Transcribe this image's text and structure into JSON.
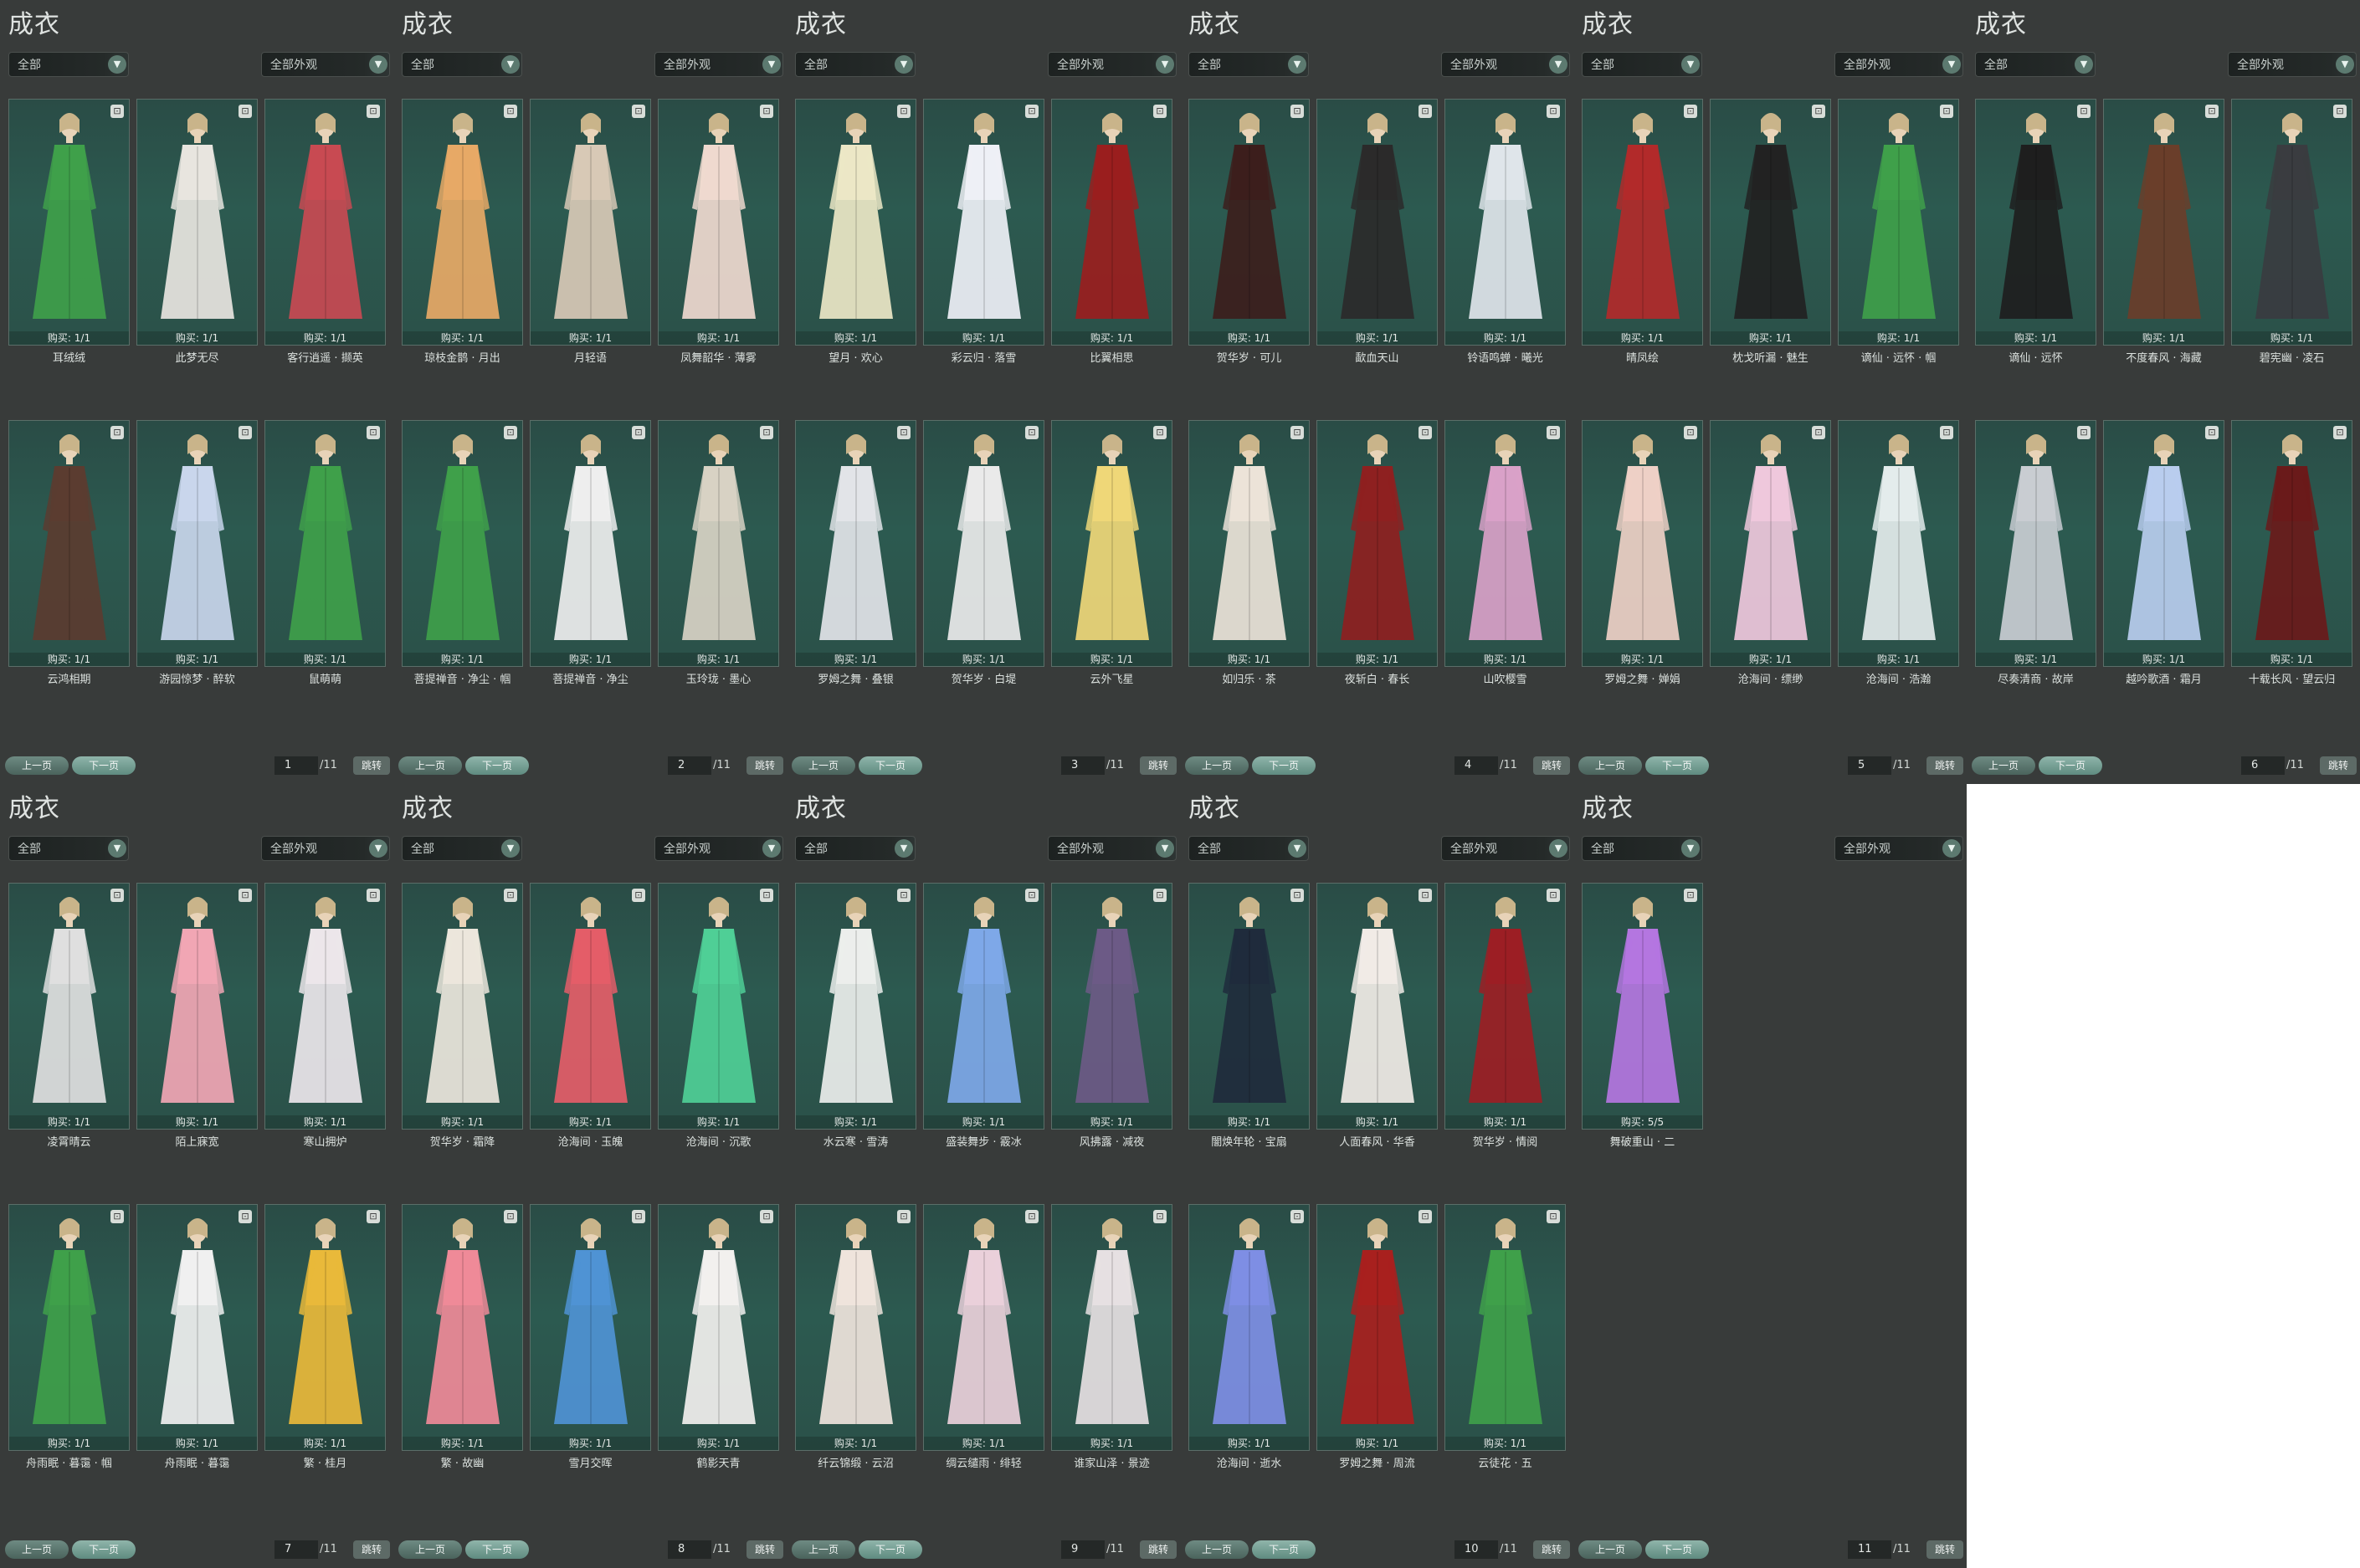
{
  "colors": {
    "panel_bg": "#383b3a",
    "card_bg": "#2c5a50",
    "page_bg": "#ffffff"
  },
  "panels": [
    {
      "title": "成衣",
      "filter_left": "全部",
      "filter_right": "全部外观",
      "items": [
        {
          "name": "耳绒绒",
          "buy": "购买: 1/1",
          "color": "#3fa04a"
        },
        {
          "name": "此梦无尽",
          "buy": "购买: 1/1",
          "color": "#e8e5df"
        },
        {
          "name": "客行逍遥 · 撷英",
          "buy": "购买: 1/1",
          "color": "#c84a52"
        },
        {
          "name": "云鸿相期",
          "buy": "购买: 1/1",
          "color": "#5b3c30"
        },
        {
          "name": "游园惊梦 · 醉软",
          "buy": "购买: 1/1",
          "color": "#c9d6ec"
        },
        {
          "name": "鼠萌萌",
          "buy": "购买: 1/1",
          "color": "#3fa04a"
        }
      ],
      "pager": {
        "prev": "上一页",
        "next": "下一页",
        "page": "1",
        "total": "/11",
        "jump": "跳转"
      }
    },
    {
      "title": "成衣",
      "filter_left": "全部",
      "filter_right": "全部外观",
      "items": [
        {
          "name": "琼枝金鹊 · 月出",
          "buy": "购买: 1/1",
          "color": "#e7a966"
        },
        {
          "name": "月轻语",
          "buy": "购买: 1/1",
          "color": "#d8c9b6"
        },
        {
          "name": "凤舞韶华 · 薄雾",
          "buy": "购买: 1/1",
          "color": "#efd9cf"
        },
        {
          "name": "菩提禅音 · 净尘 · 帼",
          "buy": "购买: 1/1",
          "color": "#3fa04a"
        },
        {
          "name": "菩提禅音 · 净尘",
          "buy": "购买: 1/1",
          "color": "#eeeeee"
        },
        {
          "name": "玉玲珑 · 墨心",
          "buy": "购买: 1/1",
          "color": "#d8d2c4"
        }
      ],
      "pager": {
        "prev": "上一页",
        "next": "下一页",
        "page": "2",
        "total": "/11",
        "jump": "跳转"
      }
    },
    {
      "title": "成衣",
      "filter_left": "全部",
      "filter_right": "全部外观",
      "items": [
        {
          "name": "望月 · 欢心",
          "buy": "购买: 1/1",
          "color": "#ece7c6"
        },
        {
          "name": "彩云归 · 落雪",
          "buy": "购买: 1/1",
          "color": "#eef0f6"
        },
        {
          "name": "比翼相思",
          "buy": "购买: 1/1",
          "color": "#9a1e1e"
        },
        {
          "name": "罗姆之舞 · 叠银",
          "buy": "购买: 1/1",
          "color": "#e2e4e8"
        },
        {
          "name": "贺华岁 · 白堤",
          "buy": "购买: 1/1",
          "color": "#eaeaea"
        },
        {
          "name": "云外飞星",
          "buy": "购买: 1/1",
          "color": "#efd778"
        }
      ],
      "pager": {
        "prev": "上一页",
        "next": "下一页",
        "page": "3",
        "total": "/11",
        "jump": "跳转"
      }
    },
    {
      "title": "成衣",
      "filter_left": "全部",
      "filter_right": "全部外观",
      "items": [
        {
          "name": "贺华岁 · 可儿",
          "buy": "购买: 1/1",
          "color": "#3c1e1c"
        },
        {
          "name": "歃血天山",
          "buy": "购买: 1/1",
          "color": "#2b2a2a"
        },
        {
          "name": "铃语鸣蝉 · 曦光",
          "buy": "购买: 1/1",
          "color": "#dfe5ea"
        },
        {
          "name": "如归乐 · 茶",
          "buy": "购买: 1/1",
          "color": "#ece3d8"
        },
        {
          "name": "夜斩白 · 春长",
          "buy": "购买: 1/1",
          "color": "#8e2020"
        },
        {
          "name": "山吹樱雪",
          "buy": "购买: 1/1",
          "color": "#d9a1c8"
        }
      ],
      "pager": {
        "prev": "上一页",
        "next": "下一页",
        "page": "4",
        "total": "/11",
        "jump": "跳转"
      }
    },
    {
      "title": "成衣",
      "filter_left": "全部",
      "filter_right": "全部外观",
      "items": [
        {
          "name": "晴凤绘",
          "buy": "购买: 1/1",
          "color": "#b22a2a"
        },
        {
          "name": "枕戈听漏 · 魅生",
          "buy": "购买: 1/1",
          "color": "#222222"
        },
        {
          "name": "谪仙 · 远怀 · 帼",
          "buy": "购买: 1/1",
          "color": "#3fa04a"
        },
        {
          "name": "罗姆之舞 · 婵娟",
          "buy": "购买: 1/1",
          "color": "#eed0c6"
        },
        {
          "name": "沧海间 · 缥缈",
          "buy": "购买: 1/1",
          "color": "#efc8dc"
        },
        {
          "name": "沧海间 · 浩瀚",
          "buy": "购买: 1/1",
          "color": "#e4ecec"
        }
      ],
      "pager": {
        "prev": "上一页",
        "next": "下一页",
        "page": "5",
        "total": "/11",
        "jump": "跳转"
      }
    },
    {
      "title": "成衣",
      "filter_left": "全部",
      "filter_right": "全部外观",
      "items": [
        {
          "name": "谪仙 · 远怀",
          "buy": "购买: 1/1",
          "color": "#1e1e1e"
        },
        {
          "name": "不度春风 · 海藏",
          "buy": "购买: 1/1",
          "color": "#6a3e2a"
        },
        {
          "name": "碧宪幽 · 凌石",
          "buy": "购买: 1/1",
          "color": "#3a3c40"
        },
        {
          "name": "尽奏清商 · 故岸",
          "buy": "购买: 1/1",
          "color": "#c9cdd2"
        },
        {
          "name": "越吟歌酒 · 霜月",
          "buy": "购买: 1/1",
          "color": "#b9cdee"
        },
        {
          "name": "十载长风 · 望云归",
          "buy": "购买: 1/1",
          "color": "#6a1a1a"
        }
      ],
      "pager": {
        "prev": "上一页",
        "next": "下一页",
        "page": "6",
        "total": "/11",
        "jump": "跳转"
      }
    },
    {
      "title": "成衣",
      "filter_left": "全部",
      "filter_right": "全部外观",
      "items": [
        {
          "name": "凌霄晴云",
          "buy": "购买: 1/1",
          "color": "#dfdfdf"
        },
        {
          "name": "陌上寐宽",
          "buy": "购买: 1/1",
          "color": "#f1a6b4"
        },
        {
          "name": "寒山拥炉",
          "buy": "购买: 1/1",
          "color": "#ece6ea"
        },
        {
          "name": "舟雨眠 · 暮霭 · 帼",
          "buy": "购买: 1/1",
          "color": "#3fa04a"
        },
        {
          "name": "舟雨眠 · 暮霭",
          "buy": "购买: 1/1",
          "color": "#f0f0f0"
        },
        {
          "name": "繁 · 桂月",
          "buy": "购买: 1/1",
          "color": "#e9b93a"
        }
      ],
      "pager": {
        "prev": "上一页",
        "next": "下一页",
        "page": "7",
        "total": "/11",
        "jump": "跳转"
      }
    },
    {
      "title": "成衣",
      "filter_left": "全部",
      "filter_right": "全部外观",
      "items": [
        {
          "name": "贺华岁 · 霜降",
          "buy": "购买: 1/1",
          "color": "#ece6dc"
        },
        {
          "name": "沧海间 · 玉魄",
          "buy": "购买: 1/1",
          "color": "#e45d68"
        },
        {
          "name": "沧海间 · 沉歌",
          "buy": "购买: 1/1",
          "color": "#4fcf96"
        },
        {
          "name": "繁 · 故幽",
          "buy": "购买: 1/1",
          "color": "#ef8a98"
        },
        {
          "name": "雪月交晖",
          "buy": "购买: 1/1",
          "color": "#4f93d4"
        },
        {
          "name": "鹤影天青",
          "buy": "购买: 1/1",
          "color": "#f2f0ee"
        }
      ],
      "pager": {
        "prev": "上一页",
        "next": "下一页",
        "page": "8",
        "total": "/11",
        "jump": "跳转"
      }
    },
    {
      "title": "成衣",
      "filter_left": "全部",
      "filter_right": "全部外观",
      "items": [
        {
          "name": "水云寒 · 雪涛",
          "buy": "购买: 1/1",
          "color": "#eceeec"
        },
        {
          "name": "盛装舞步 · 霰冰",
          "buy": "购买: 1/1",
          "color": "#7ea8e8"
        },
        {
          "name": "风拂露 · 减夜",
          "buy": "购买: 1/1",
          "color": "#6c5a86"
        },
        {
          "name": "纤云锦缎 · 云沼",
          "buy": "购买: 1/1",
          "color": "#efe4dc"
        },
        {
          "name": "绸云缱雨 · 绯轻",
          "buy": "购买: 1/1",
          "color": "#ead0da"
        },
        {
          "name": "谁家山泽 · 景迹",
          "buy": "购买: 1/1",
          "color": "#e6e0e2"
        }
      ],
      "pager": {
        "prev": "上一页",
        "next": "下一页",
        "page": "9",
        "total": "/11",
        "jump": "跳转"
      }
    },
    {
      "title": "成衣",
      "filter_left": "全部",
      "filter_right": "全部外观",
      "items": [
        {
          "name": "闇焕年轮 · 宝扇",
          "buy": "购买: 1/1",
          "color": "#1f2b3c"
        },
        {
          "name": "人面春风 · 华香",
          "buy": "购买: 1/1",
          "color": "#f1ebe6"
        },
        {
          "name": "贺华岁 · 情阅",
          "buy": "购买: 1/1",
          "color": "#9c1e24"
        },
        {
          "name": "沧海间 · 逝水",
          "buy": "购买: 1/1",
          "color": "#7e8ee4"
        },
        {
          "name": "罗姆之舞 · 周流",
          "buy": "购买: 1/1",
          "color": "#a8201e"
        },
        {
          "name": "云徒花 · 五",
          "buy": "购买: 1/1",
          "color": "#3fa04a"
        }
      ],
      "pager": {
        "prev": "上一页",
        "next": "下一页",
        "page": "10",
        "total": "/11",
        "jump": "跳转"
      }
    },
    {
      "title": "成衣",
      "filter_left": "全部",
      "filter_right": "全部外观",
      "items": [
        {
          "name": "舞破重山 · 二",
          "buy": "购买: 5/5",
          "color": "#b476e0"
        }
      ],
      "pager": {
        "prev": "上一页",
        "next": "下一页",
        "page": "11",
        "total": "/11",
        "jump": "跳转"
      }
    }
  ]
}
